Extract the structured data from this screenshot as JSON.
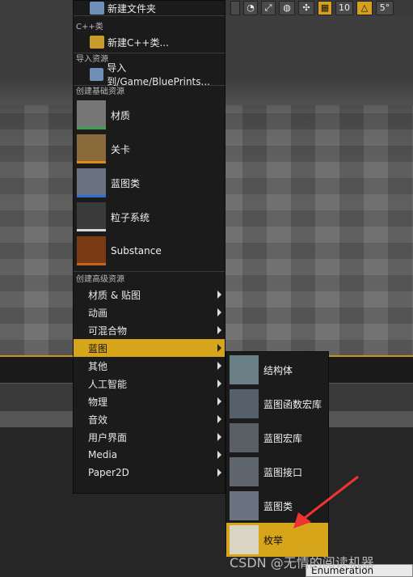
{
  "toolbar": {
    "num1": "10",
    "num2": "5°"
  },
  "menu": {
    "new_folder": "新建文件夹",
    "cpp_section": "C++类",
    "new_cpp": "新建C++类...",
    "import_section": "导入资源",
    "import_to": "导入到/Game/BluePrints...",
    "basic_section": "创建基础资源",
    "basic_items": [
      {
        "label": "材质",
        "color": "#3fa34d"
      },
      {
        "label": "关卡",
        "color": "#e08a1e"
      },
      {
        "label": "蓝图类",
        "color": "#2b6fd6"
      },
      {
        "label": "粒子系统",
        "color": "#d8d8d8"
      },
      {
        "label": "Substance",
        "color": "#c5641f"
      }
    ],
    "advanced_section": "创建高级资源",
    "advanced_items": [
      "材质 & 贴图",
      "动画",
      "可混合物",
      "蓝图",
      "其他",
      "人工智能",
      "物理",
      "音效",
      "用户界面",
      "Media",
      "Paper2D"
    ]
  },
  "submenu": {
    "items": [
      "结构体",
      "蓝图函数宏库",
      "蓝图宏库",
      "蓝图接口",
      "蓝图类",
      "枚举"
    ]
  },
  "tooltip": "Enumeration",
  "watermark": "CSDN @无情的阅读机器",
  "accent_color": "#d6a51a"
}
